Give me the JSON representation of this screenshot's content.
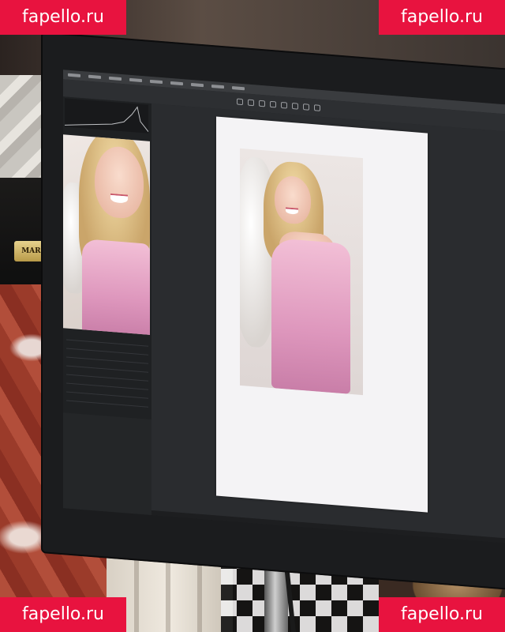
{
  "nameplate": {
    "text": "MARC"
  },
  "watermarks": {
    "top_left": "fapello.ru",
    "top_right": "fapello.ru",
    "bottom_left": "fapello.ru",
    "bottom_right": "fapello.ru"
  },
  "colors": {
    "watermark": "#e8133f",
    "dress": "#de97bd",
    "paper": "#f4f3f5"
  }
}
